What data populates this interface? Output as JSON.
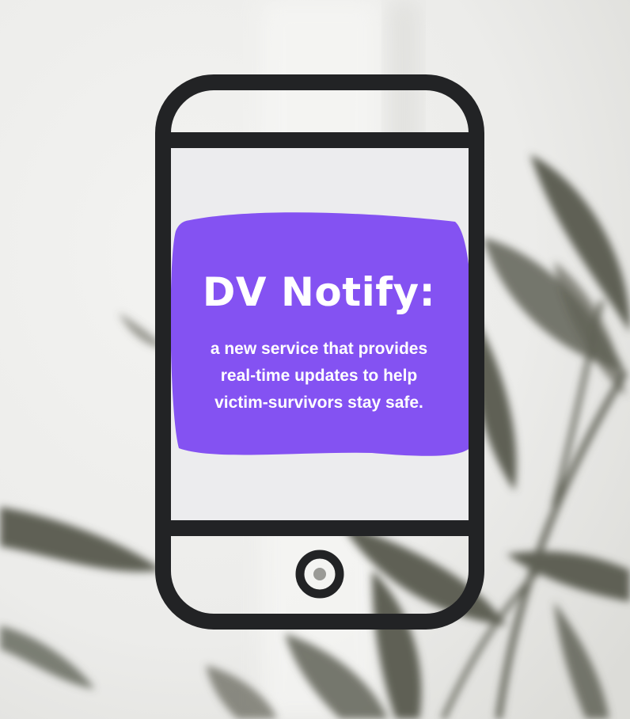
{
  "headline": "DV Notify:",
  "tagline_lines": [
    "a new service that provides",
    "real-time updates to help",
    "victim-survivors stay safe."
  ],
  "colors": {
    "background": "#ededec",
    "leaf_shadow": "#5f6155",
    "phone_outline": "#222325",
    "screen": "#ececee",
    "purple_blob": "#8452f2",
    "text": "#ffffff"
  },
  "icons": [
    "smartphone-icon",
    "home-button-icon"
  ]
}
